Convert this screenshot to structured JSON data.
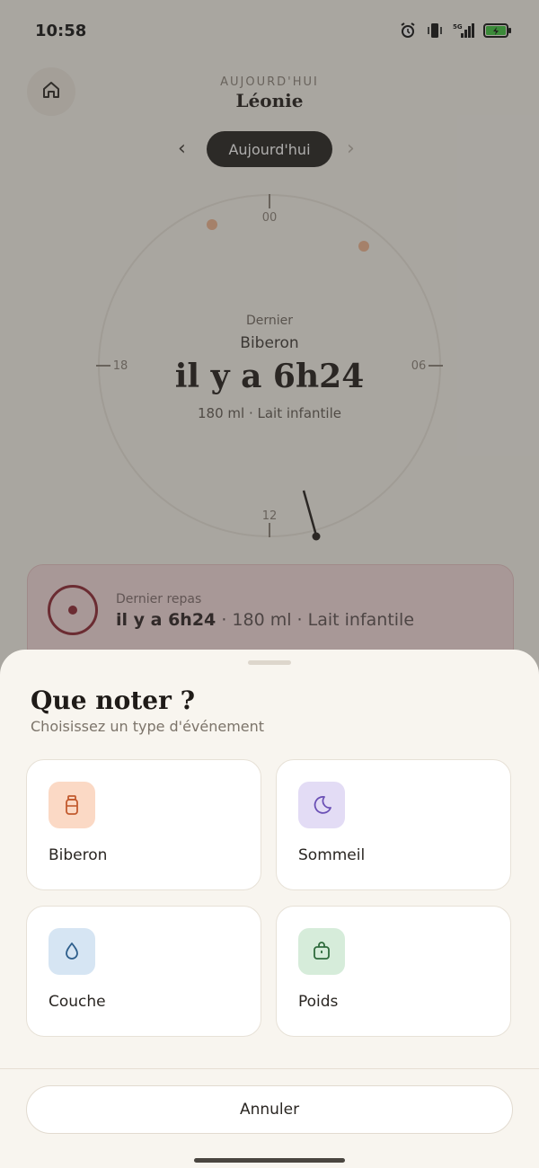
{
  "status_bar": {
    "time": "10:58",
    "network": "5G"
  },
  "header": {
    "subtitle": "AUJOURD'HUI",
    "name": "Léonie"
  },
  "day_nav": {
    "current": "Aujourd'hui"
  },
  "clock": {
    "hour_labels": [
      "00",
      "06",
      "12",
      "18"
    ],
    "last_label": "Dernier",
    "last_type": "Biberon",
    "time_ago": "il y a 6h24",
    "detail": "180 ml · Lait infantile"
  },
  "last_meal": {
    "label": "Dernier repas",
    "time_ago": "il y a 6h24",
    "amount": "180 ml",
    "kind": "Lait infantile",
    "separator": "·"
  },
  "sheet": {
    "title": "Que noter ?",
    "subtitle": "Choisissez un type d'événement",
    "options": [
      {
        "label": "Biberon",
        "icon": "bottle-icon",
        "color": "#fbd9c5"
      },
      {
        "label": "Sommeil",
        "icon": "moon-icon",
        "color": "#e3dcf5"
      },
      {
        "label": "Couche",
        "icon": "drop-icon",
        "color": "#d6e5f3"
      },
      {
        "label": "Poids",
        "icon": "weight-icon",
        "color": "#d6ecda"
      }
    ],
    "cancel_label": "Annuler"
  }
}
